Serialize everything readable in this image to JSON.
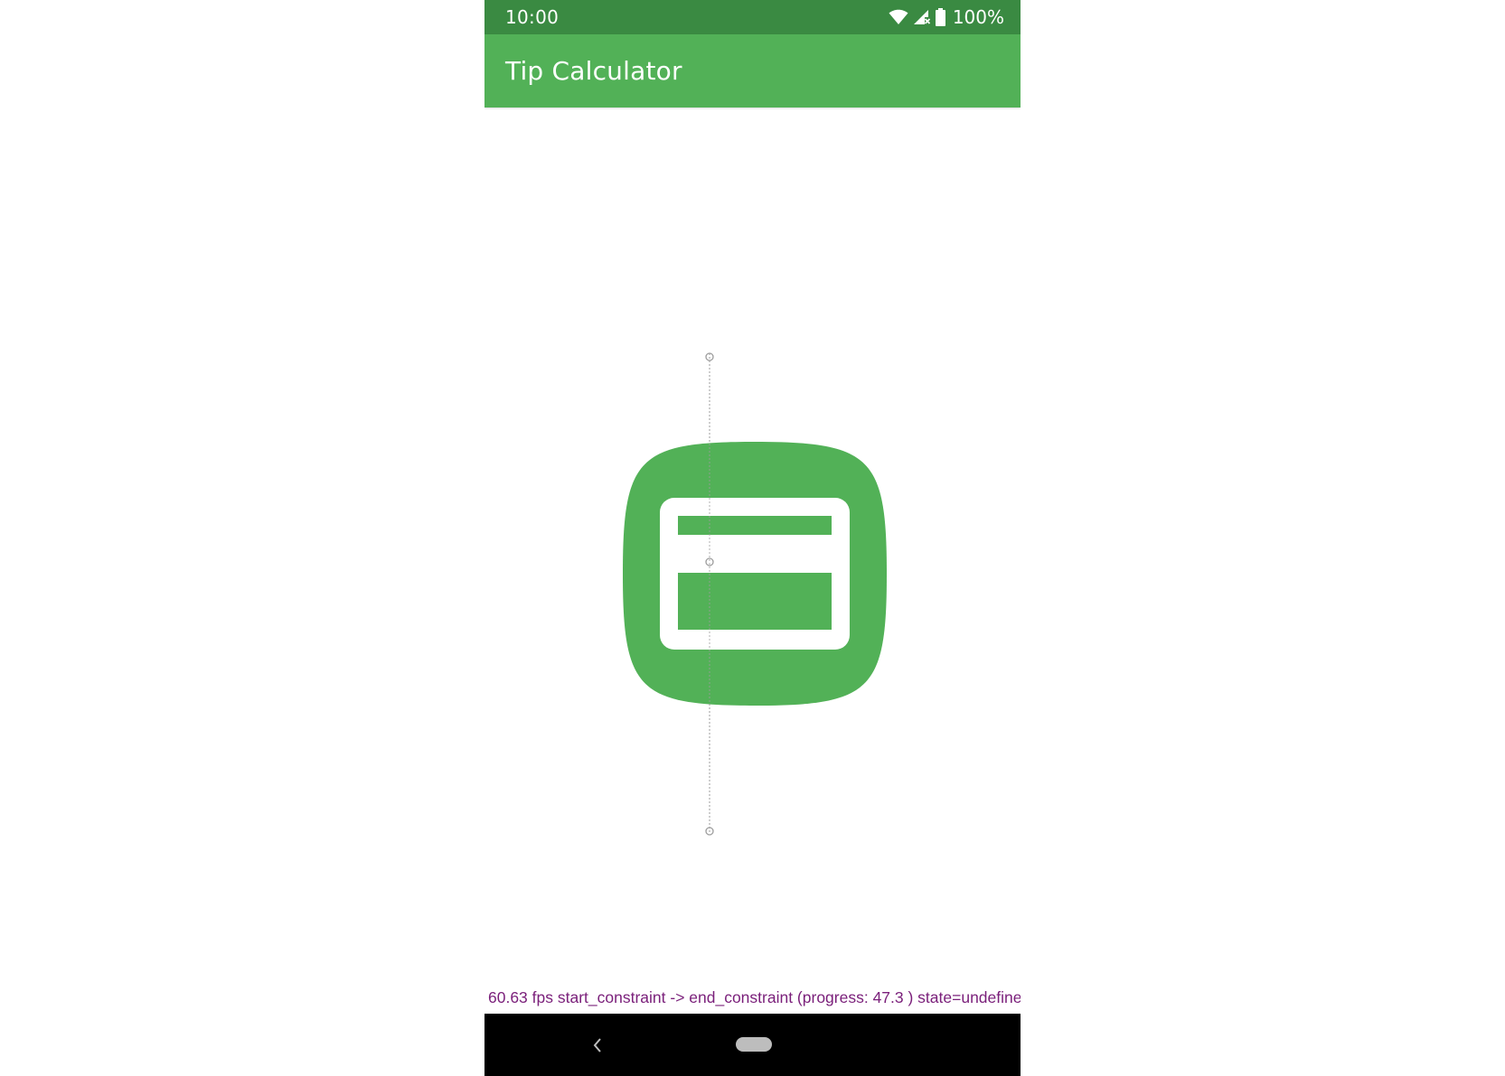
{
  "status_bar": {
    "time": "10:00",
    "battery_percent": "100%",
    "icons": [
      "wifi-icon",
      "cell-signal-icon",
      "battery-icon"
    ],
    "background": "#3a8a42"
  },
  "app_bar": {
    "title": "Tip Calculator",
    "background": "#52b157"
  },
  "content": {
    "logo_icon": "credit-card-icon",
    "logo_color": "#52b157"
  },
  "debug": {
    "text": "60.63 fps start_constraint -> end_constraint (progress: 47.3 ) state=undefine",
    "color": "#7a1f7a"
  },
  "nav_bar": {
    "icons": [
      "back-icon",
      "home-pill-icon"
    ]
  }
}
